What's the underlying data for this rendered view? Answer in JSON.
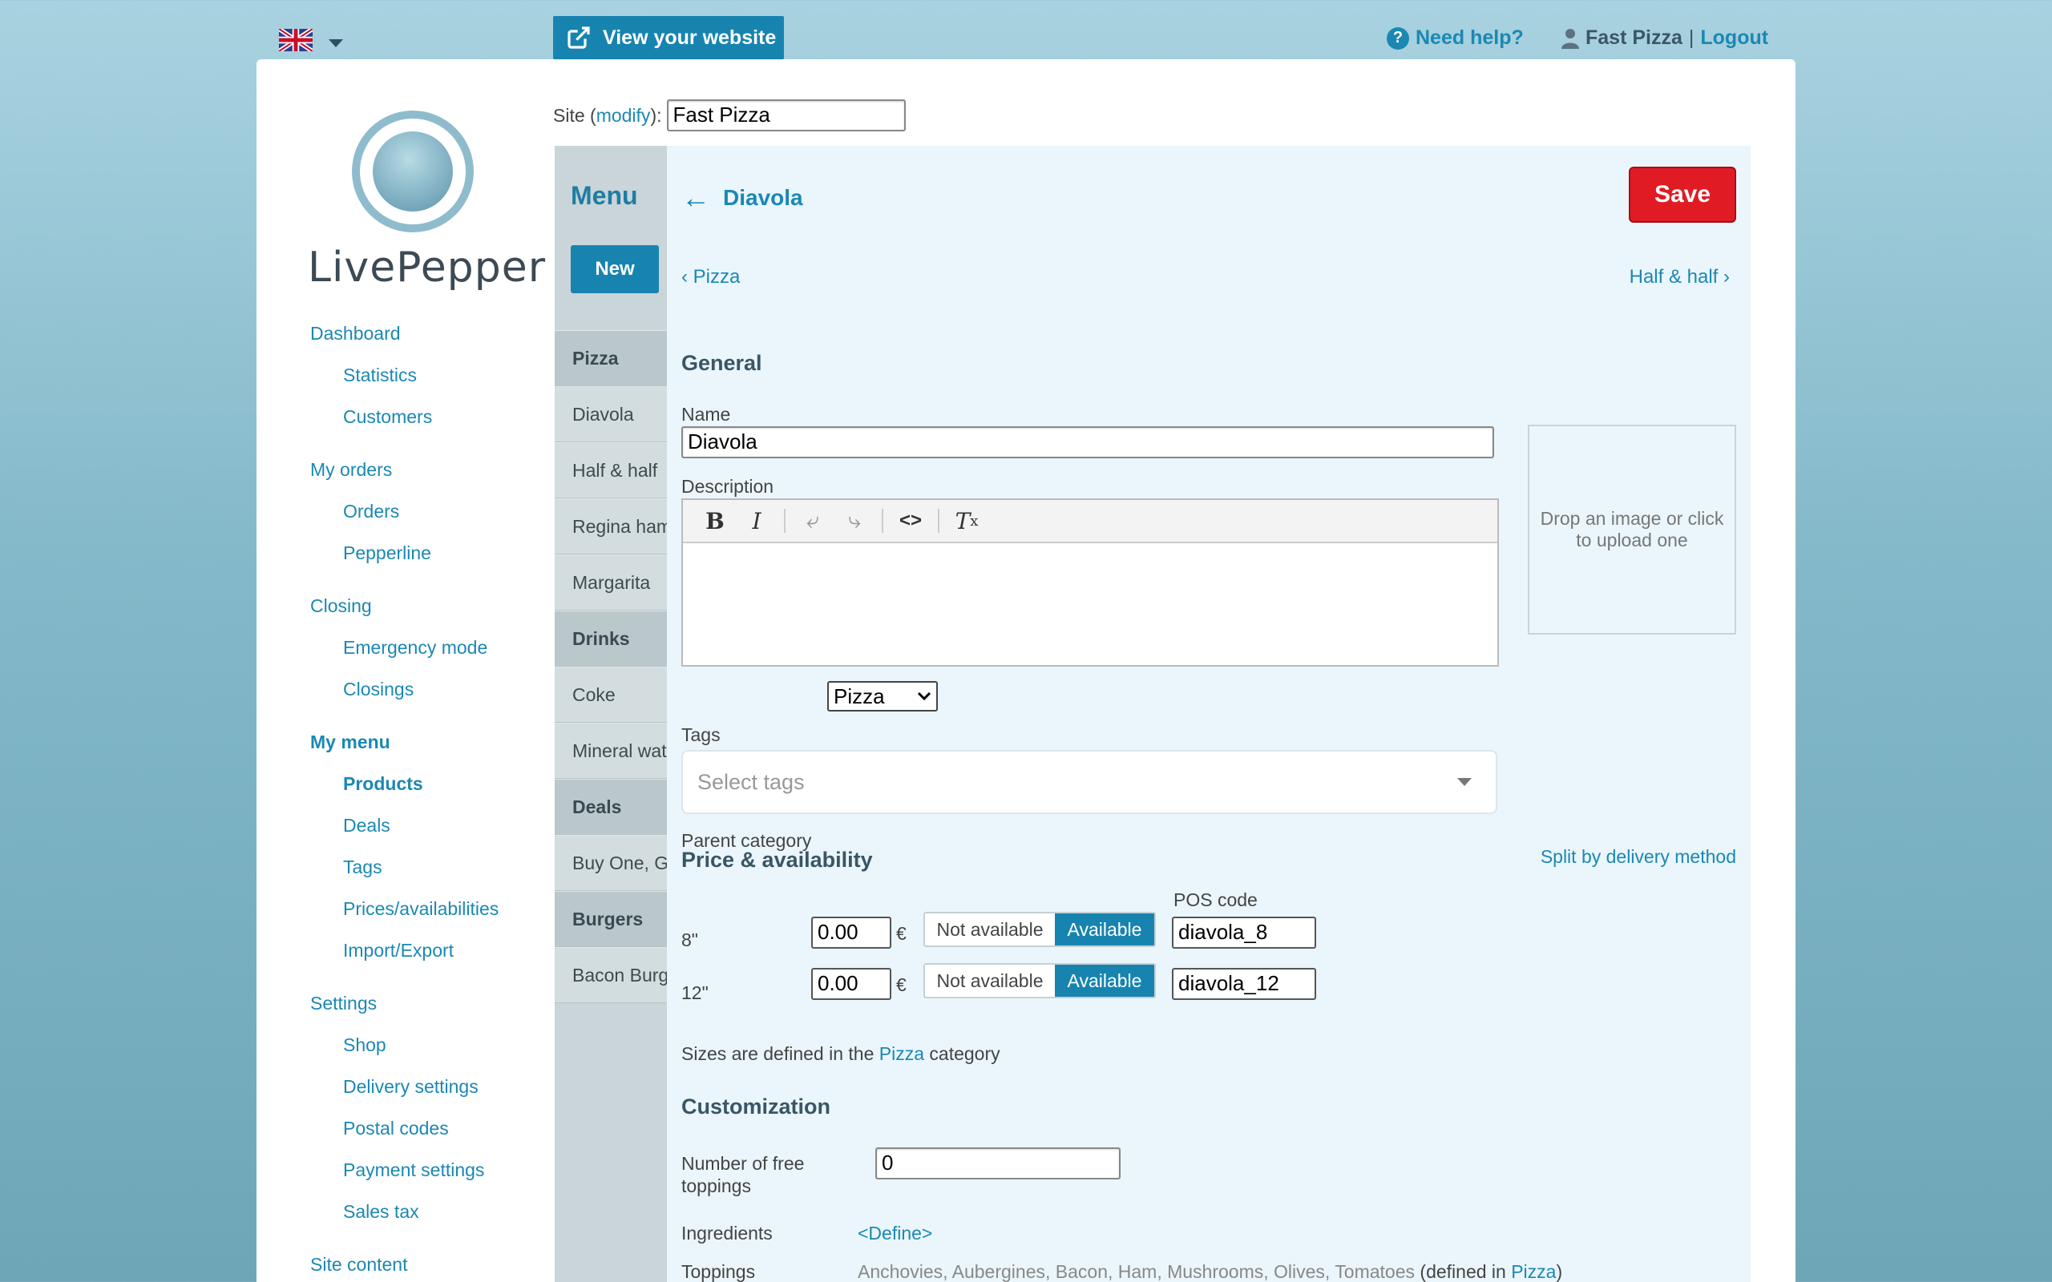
{
  "topbar": {
    "language_icon": "uk-flag-icon",
    "view_website_label": "View your website",
    "need_help_label": "Need help?",
    "user_name": "Fast Pizza",
    "separator": "|",
    "logout_label": "Logout"
  },
  "logo": {
    "text": "LivePepper"
  },
  "site": {
    "label_prefix": "Site (",
    "modify_label": "modify",
    "label_suffix": "):",
    "value": "Fast Pizza"
  },
  "sidebar": {
    "sections": [
      {
        "label": "Dashboard",
        "items": [
          "Statistics",
          "Customers"
        ]
      },
      {
        "label": "My orders",
        "items": [
          "Orders",
          "Pepperline"
        ]
      },
      {
        "label": "Closing",
        "items": [
          "Emergency mode",
          "Closings"
        ]
      },
      {
        "label": "My menu",
        "items": [
          "Products",
          "Deals",
          "Tags",
          "Prices/availabilities",
          "Import/Export"
        ]
      },
      {
        "label": "Settings",
        "items": [
          "Shop",
          "Delivery settings",
          "Postal codes",
          "Payment settings",
          "Sales tax"
        ]
      },
      {
        "label": "Site content",
        "items": []
      }
    ]
  },
  "menu": {
    "title": "Menu",
    "new_label": "New",
    "rows": [
      {
        "label": "Pizza",
        "category": true
      },
      {
        "label": "Diavola",
        "category": false
      },
      {
        "label": "Half & half",
        "category": false
      },
      {
        "label": "Regina ham",
        "category": false
      },
      {
        "label": "Margarita",
        "category": false
      },
      {
        "label": "Drinks",
        "category": true
      },
      {
        "label": "Coke",
        "category": false
      },
      {
        "label": "Mineral water",
        "category": false
      },
      {
        "label": "Deals",
        "category": true
      },
      {
        "label": "Buy One, Get One",
        "category": false
      },
      {
        "label": "Burgers",
        "category": true
      },
      {
        "label": "Bacon Burger",
        "category": false
      }
    ]
  },
  "editor": {
    "back_arrow": "←",
    "title": "Diavola",
    "save_label": "Save",
    "prev_label": "Pizza",
    "next_label": "Half & half",
    "general_heading": "General",
    "name_label": "Name",
    "name_value": "Diavola",
    "description_label": "Description",
    "dropzone_text": "Drop an image or click to upload one",
    "parent_category_label": "Parent category",
    "parent_category_value": "Pizza",
    "tags_label": "Tags",
    "tags_placeholder": "Select tags",
    "price_heading": "Price & availability",
    "split_label": "Split by delivery method",
    "pos_code_label": "POS code",
    "currency": "€",
    "sizes": [
      {
        "size": "8\"",
        "price": "0.00",
        "off_label": "Not available",
        "on_label": "Available",
        "pos_code": "diavola_8"
      },
      {
        "size": "12\"",
        "price": "0.00",
        "off_label": "Not available",
        "on_label": "Available",
        "pos_code": "diavola_12"
      }
    ],
    "sizes_note_prefix": "Sizes are defined in the ",
    "sizes_note_link": "Pizza",
    "sizes_note_suffix": " category",
    "customization_heading": "Customization",
    "free_toppings_label": "Number of free toppings",
    "free_toppings_value": "0",
    "ingredients_label": "Ingredients",
    "ingredients_define": "<Define>",
    "toppings_label": "Toppings",
    "toppings_list": "Anchovies, Aubergines, Bacon, Ham, Mushrooms, Olives, Tomatoes",
    "toppings_note_prefix": " (defined in ",
    "toppings_note_link": "Pizza",
    "toppings_note_suffix": ")"
  },
  "colors": {
    "accent": "#1784b0",
    "save": "#e01b24",
    "editor_bg": "#eaf6fb"
  }
}
